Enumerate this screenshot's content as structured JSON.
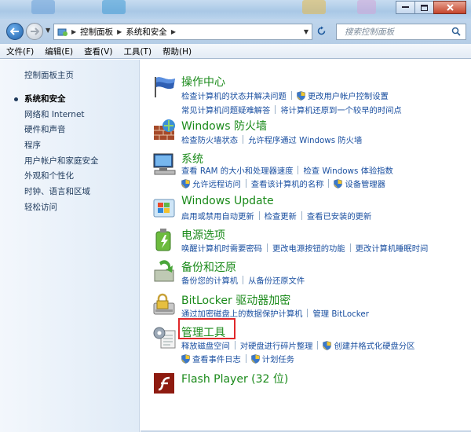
{
  "address": {
    "breadcrumb": [
      "控制面板",
      "系统和安全"
    ],
    "search_placeholder": "搜索控制面板"
  },
  "menu": [
    "文件(F)",
    "编辑(E)",
    "查看(V)",
    "工具(T)",
    "帮助(H)"
  ],
  "sidebar": {
    "home": "控制面板主页",
    "items": [
      {
        "label": "系统和安全",
        "current": true
      },
      {
        "label": "网络和 Internet"
      },
      {
        "label": "硬件和声音"
      },
      {
        "label": "程序"
      },
      {
        "label": "用户帐户和家庭安全"
      },
      {
        "label": "外观和个性化"
      },
      {
        "label": "时钟、语言和区域"
      },
      {
        "label": "轻松访问"
      }
    ]
  },
  "categories": {
    "action_center": {
      "title": "操作中心",
      "row1": [
        "检查计算机的状态并解决问题",
        "更改用户帐户控制设置"
      ],
      "row2": [
        "常见计算机问题疑难解答",
        "将计算机还原到一个较早的时间点"
      ]
    },
    "firewall": {
      "title": "Windows 防火墙",
      "row1": [
        "检查防火墙状态",
        "允许程序通过 Windows 防火墙"
      ]
    },
    "system": {
      "title": "系统",
      "row1": [
        "查看 RAM 的大小和处理器速度",
        "检查 Windows 体验指数"
      ],
      "row2": [
        "允许远程访问",
        "查看该计算机的名称",
        "设备管理器"
      ]
    },
    "windows_update": {
      "title": "Windows Update",
      "row1": [
        "启用或禁用自动更新",
        "检查更新",
        "查看已安装的更新"
      ]
    },
    "power": {
      "title": "电源选项",
      "row1": [
        "唤醒计算机时需要密码",
        "更改电源按钮的功能",
        "更改计算机睡眠时间"
      ]
    },
    "backup": {
      "title": "备份和还原",
      "row1": [
        "备份您的计算机",
        "从备份还原文件"
      ]
    },
    "bitlocker": {
      "title": "BitLocker 驱动器加密",
      "row1": [
        "通过加密磁盘上的数据保护计算机",
        "管理 BitLocker"
      ]
    },
    "admin_tools": {
      "title": "管理工具",
      "row1": [
        "释放磁盘空间",
        "对硬盘进行碎片整理",
        "创建并格式化硬盘分区"
      ],
      "row2": [
        "查看事件日志",
        "计划任务"
      ]
    },
    "flash": {
      "title": "Flash Player (32 位)"
    }
  },
  "colors": {
    "category_title": "#1a8a1a",
    "link": "#1a4fa0",
    "highlight_box": "#e0282b"
  }
}
